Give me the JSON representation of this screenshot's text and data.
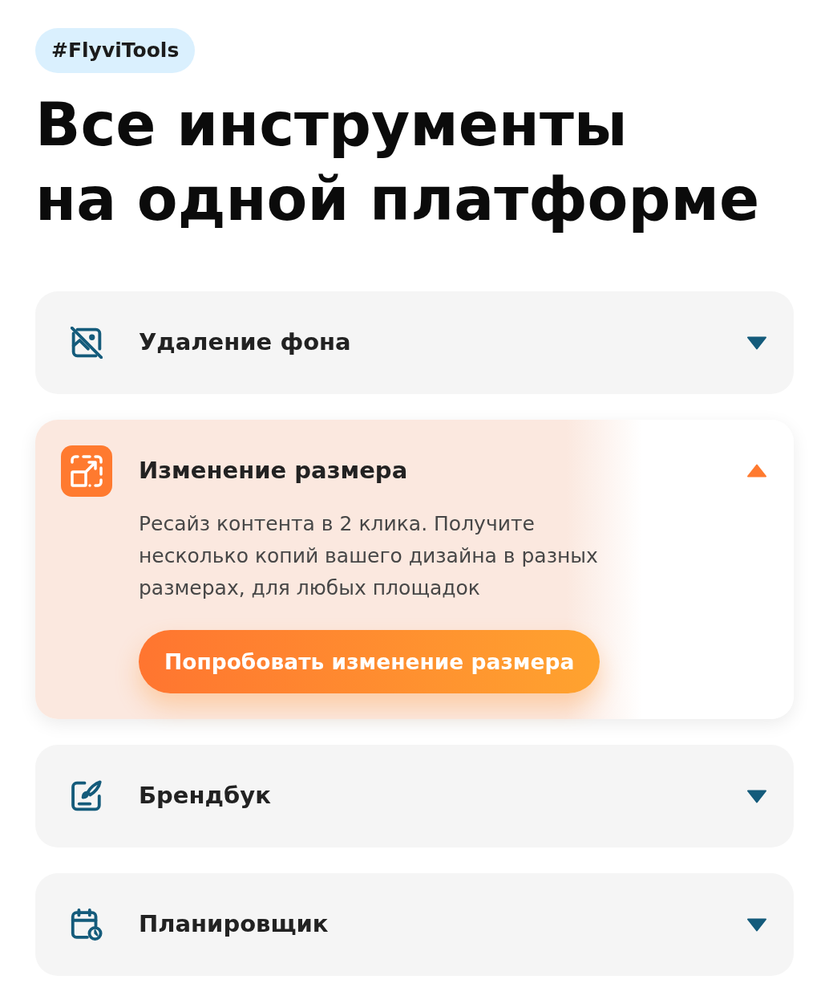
{
  "tag": "#FlyviTools",
  "heading_lines": [
    "Все инструменты",
    "на одной платформе"
  ],
  "tools": [
    {
      "title": "Удаление фона",
      "expanded": false
    },
    {
      "title": "Изменение размера",
      "expanded": true,
      "description": "Ресайз контента в 2 клика. Получите несколько копий вашего дизайна в разных размерах, для любых площадок",
      "button": "Попробовать изменение размера"
    },
    {
      "title": "Брендбук",
      "expanded": false
    },
    {
      "title": "Планировщик",
      "expanded": false
    }
  ]
}
